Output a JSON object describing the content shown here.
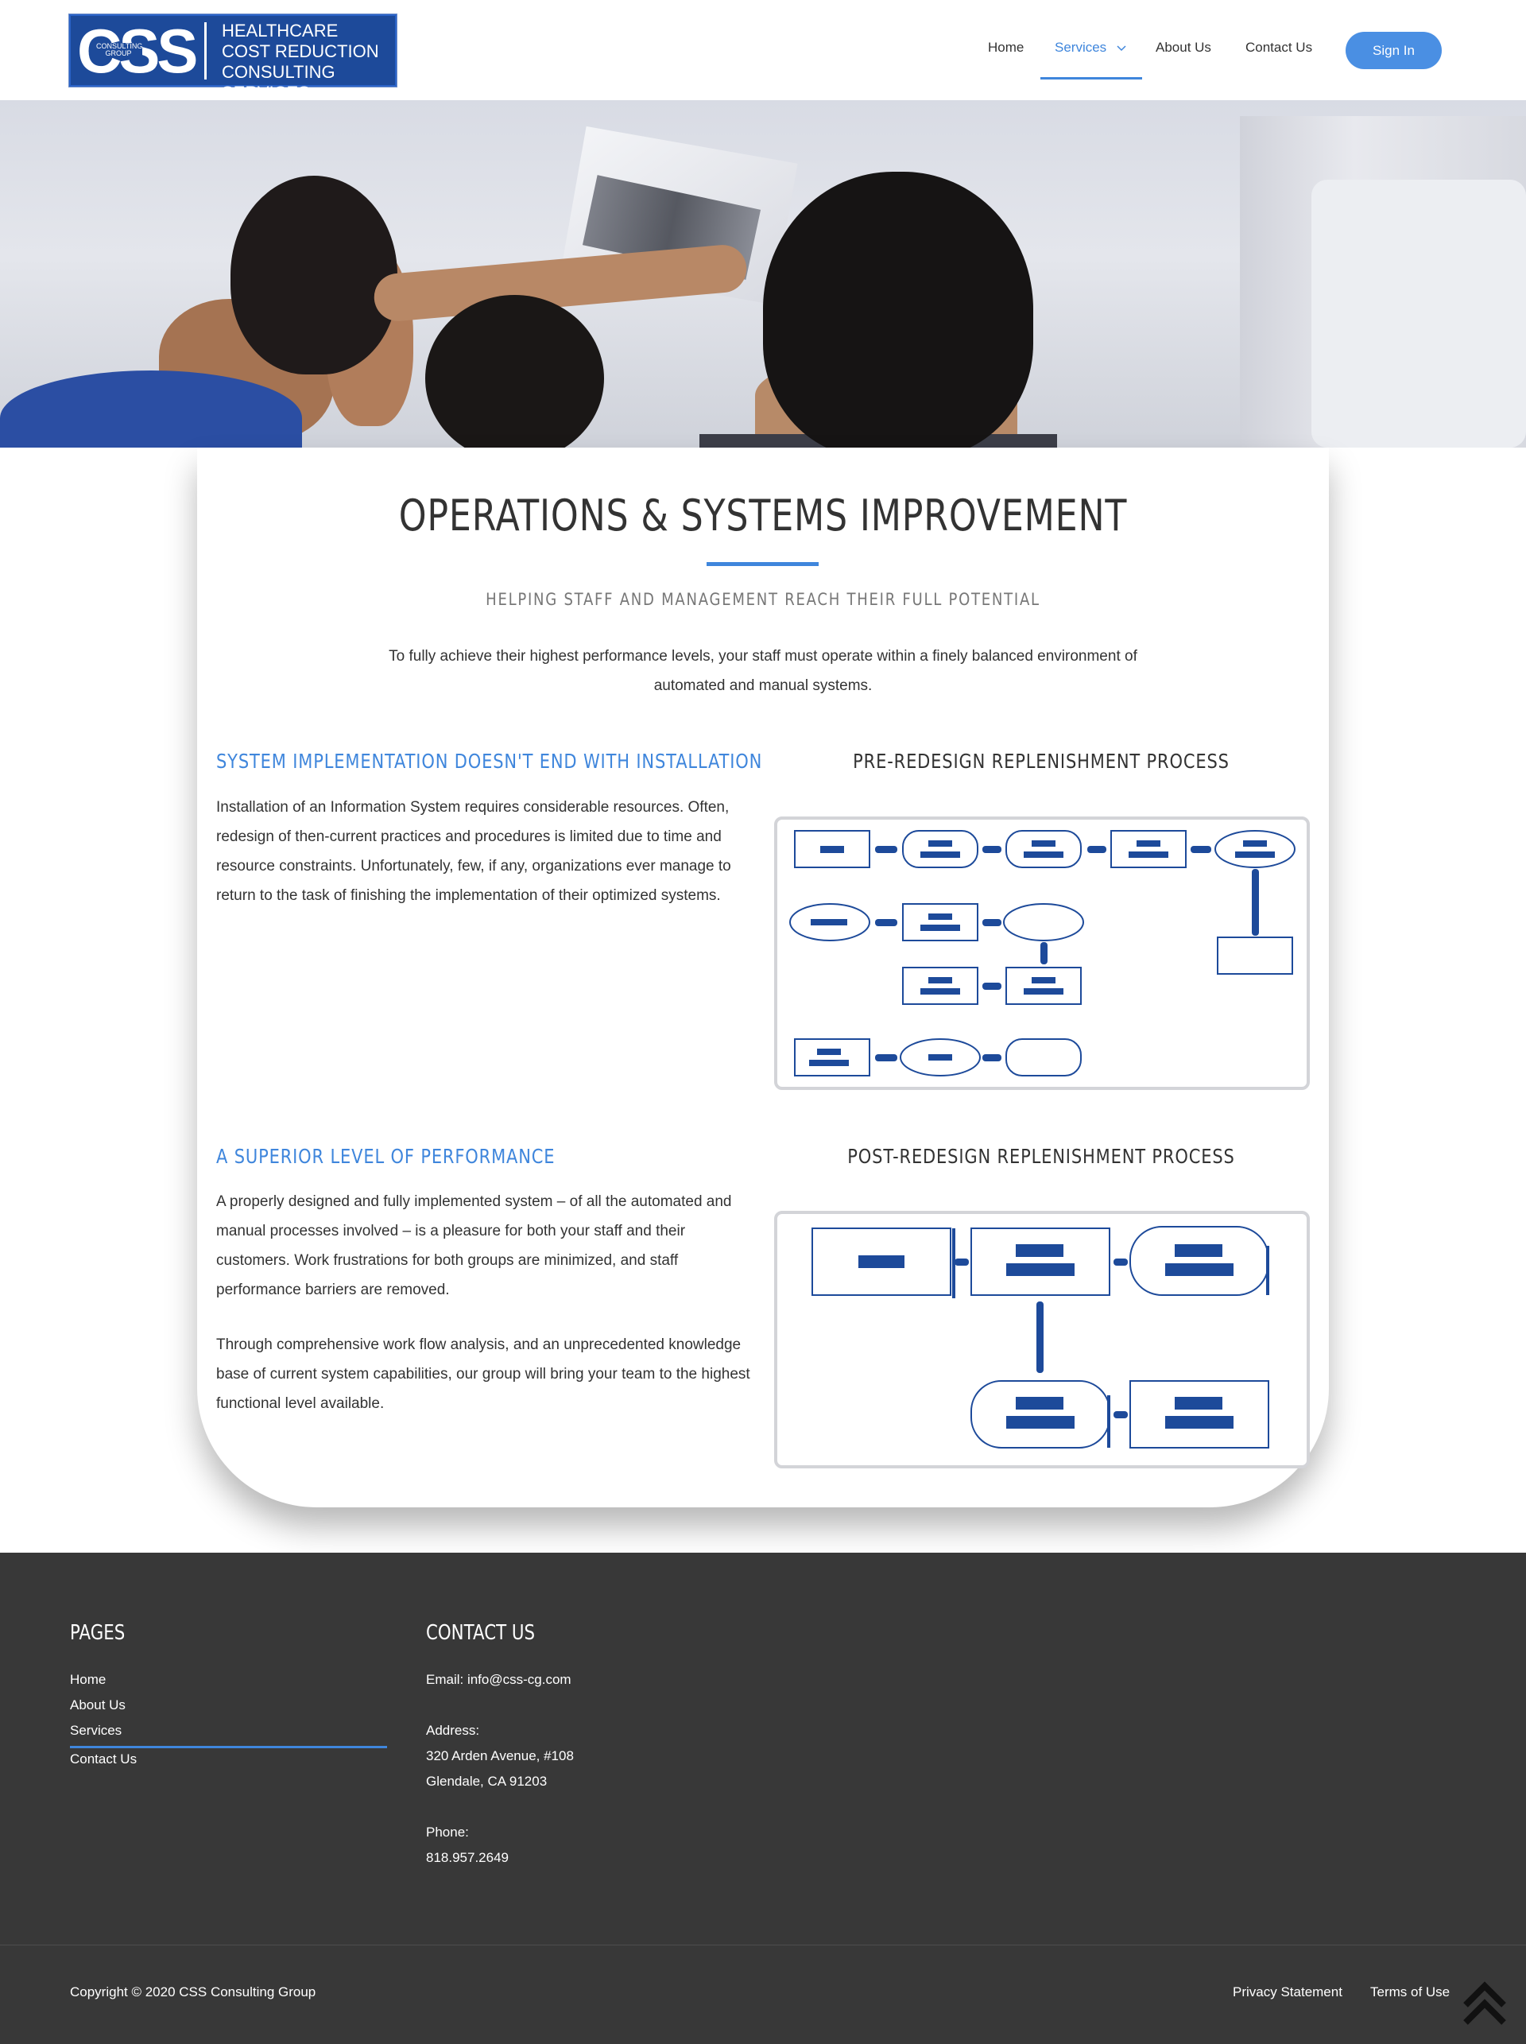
{
  "header": {
    "logo": {
      "mark": "CSS",
      "mark_sub": "CONSULTING GROUP",
      "lines": [
        "HEALTHCARE",
        "COST REDUCTION",
        "CONSULTING SERVICES"
      ]
    },
    "nav": {
      "home": "Home",
      "services": "Services",
      "about": "About Us",
      "contact": "Contact Us",
      "signin": "Sign In"
    }
  },
  "main": {
    "title": "OPERATIONS & SYSTEMS IMPROVEMENT",
    "subtitle": "HELPING STAFF AND MANAGEMENT REACH THEIR FULL POTENTIAL",
    "intro": "To fully achieve their highest performance levels, your staff must operate within a finely balanced environment of automated and manual systems.",
    "section1": {
      "heading": "SYSTEM IMPLEMENTATION DOESN'T END WITH INSTALLATION",
      "body": "Installation of an Information System requires considerable resources. Often, redesign of then-current practices and procedures is limited due to time and resource constraints. Unfortunately, few, if any, organizations ever manage to return to the task of finishing the implementation of their optimized systems.",
      "diagram_title": "PRE-REDESIGN REPLENISHMENT PROCESS"
    },
    "section2": {
      "heading": "A SUPERIOR LEVEL OF PERFORMANCE",
      "body1": "A properly designed and fully implemented system – of all the automated and manual processes involved – is a pleasure for both your staff and their customers. Work frustrations for both groups are minimized, and staff performance barriers are removed.",
      "body2": "Through comprehensive work flow analysis, and an unprecedented knowledge base of current system capabilities, our group will bring your team to the highest functional level available.",
      "diagram_title": "POST-REDESIGN REPLENISHMENT PROCESS"
    }
  },
  "footer": {
    "pages_heading": "PAGES",
    "pages": [
      "Home",
      "About Us",
      "Services",
      "Contact Us"
    ],
    "contact_heading": "CONTACT US",
    "email": "Email: info@css-cg.com",
    "address_label": "Address:",
    "address_line1": "320 Arden Avenue, #108",
    "address_line2": "Glendale, CA 91203",
    "phone_label": "Phone:",
    "phone": "818.957.2649",
    "copyright": "Copyright © 2020 CSS Consulting Group",
    "privacy": "Privacy Statement",
    "terms": "Terms of Use"
  },
  "colors": {
    "accent": "#3f86dc",
    "diagram_blue": "#1d4a9a",
    "footer_bg": "#383838"
  },
  "icons": [
    "chevron-down-icon",
    "scroll-to-top-icon"
  ]
}
